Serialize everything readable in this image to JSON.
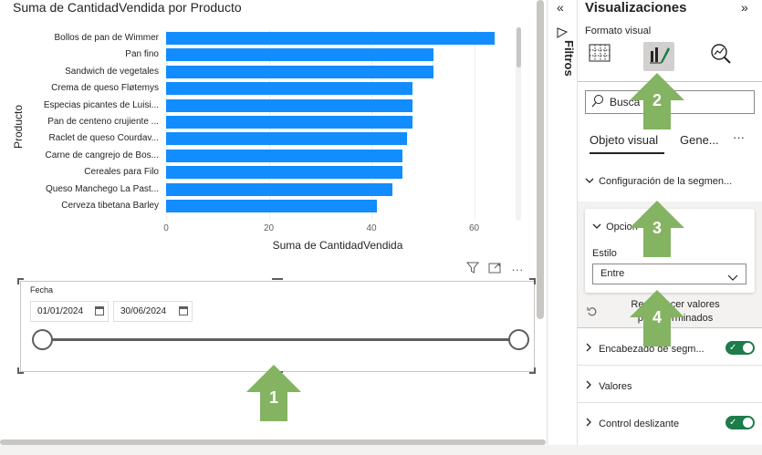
{
  "chart": {
    "title": "Suma de CantidadVendida por Producto",
    "x_axis_title": "Suma de CantidadVendida",
    "y_axis_title": "Producto"
  },
  "chart_data": {
    "type": "bar",
    "orientation": "horizontal",
    "title": "Suma de CantidadVendida por Producto",
    "xlabel": "Suma de CantidadVendida",
    "ylabel": "Producto",
    "categories": [
      "Bollos de pan de Wimmer",
      "Pan fino",
      "Sandwich de vegetales",
      "Crema de queso Fløtemys",
      "Especias picantes de Luisi...",
      "Pan de centeno crujiente ...",
      "Raclet de queso Courdav...",
      "Carne de cangrejo de Bos...",
      "Cereales para Filo",
      "Queso Manchego La Past...",
      "Cerveza tibetana Barley"
    ],
    "values": [
      64,
      52,
      52,
      48,
      48,
      48,
      47,
      46,
      46,
      44,
      41
    ],
    "xlim": [
      0,
      72
    ],
    "xticks": [
      "0",
      "20",
      "40",
      "60"
    ],
    "bar_color": "#118dff",
    "grid": true
  },
  "visual_toolbar": {
    "filter_icon": "filter-icon",
    "focus_icon": "focus-mode-icon",
    "more_icon": "more-options-icon",
    "more_label": "···"
  },
  "slicer": {
    "label": "Fecha",
    "start_date": "01/01/2024",
    "end_date": "30/06/2024",
    "range_start": 0,
    "range_end": 1
  },
  "filters_pane": {
    "collapse_label": "«",
    "title": "Filtros"
  },
  "viz_pane": {
    "title": "Visualizaciones",
    "expand_label": "»",
    "subtitle": "Formato visual",
    "search_placeholder": "Busca",
    "tabs": [
      "Objeto visual",
      "Gene...",
      "···"
    ],
    "section_config": "Configuración de la segmen...",
    "subsection_options": "Opcion",
    "style_label": "Estilo",
    "style_value": "Entre",
    "reset_label_line1": "Restablecer valores",
    "reset_label_line2": "predeterminados",
    "sections": [
      {
        "label": "Encabezado de segm...",
        "toggle": true
      },
      {
        "label": "Valores",
        "toggle": false
      },
      {
        "label": "Control deslizante",
        "toggle": true
      }
    ]
  },
  "annotations": [
    "1",
    "2",
    "3",
    "4"
  ],
  "colors": {
    "bar": "#118dff",
    "toggle_on": "#1e7b4a",
    "annotation_arrow": "#84b362"
  }
}
